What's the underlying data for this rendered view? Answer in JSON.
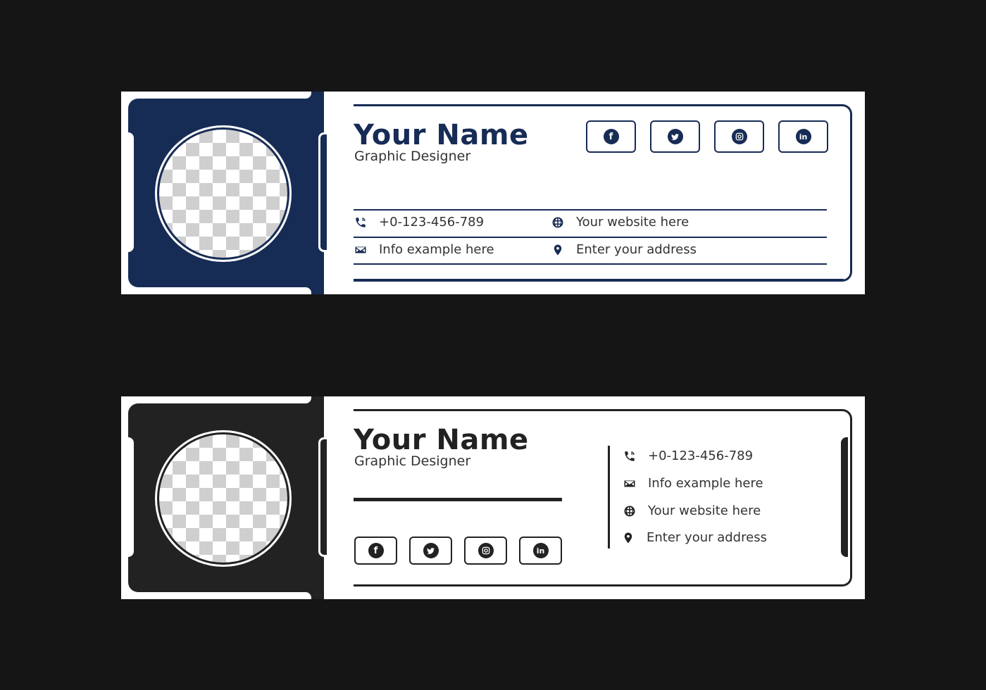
{
  "colors": {
    "background": "#151515",
    "card1_accent": "#172c55",
    "card2_accent": "#222222",
    "card_bg": "#ffffff"
  },
  "cards": [
    {
      "variant": "navy",
      "name": "Your Name",
      "role": "Graphic Designer",
      "social": [
        {
          "icon": "facebook-icon",
          "glyph": "f"
        },
        {
          "icon": "twitter-icon",
          "glyph": "t"
        },
        {
          "icon": "instagram-icon",
          "glyph": "◎"
        },
        {
          "icon": "linkedin-icon",
          "glyph": "in"
        }
      ],
      "contacts": [
        {
          "icon": "phone-icon",
          "text": "+0-123-456-789"
        },
        {
          "icon": "globe-icon",
          "text": "Your website here"
        },
        {
          "icon": "mail-icon",
          "text": "Info example here"
        },
        {
          "icon": "location-pin-icon",
          "text": "Enter your address"
        }
      ]
    },
    {
      "variant": "dark",
      "name": "Your Name",
      "role": "Graphic Designer",
      "social": [
        {
          "icon": "facebook-icon",
          "glyph": "f"
        },
        {
          "icon": "twitter-icon",
          "glyph": "t"
        },
        {
          "icon": "instagram-icon",
          "glyph": "◎"
        },
        {
          "icon": "linkedin-icon",
          "glyph": "in"
        }
      ],
      "contacts": [
        {
          "icon": "phone-icon",
          "text": "+0-123-456-789"
        },
        {
          "icon": "mail-icon",
          "text": "Info example here"
        },
        {
          "icon": "globe-icon",
          "text": "Your website here"
        },
        {
          "icon": "location-pin-icon",
          "text": "Enter your address"
        }
      ]
    }
  ]
}
